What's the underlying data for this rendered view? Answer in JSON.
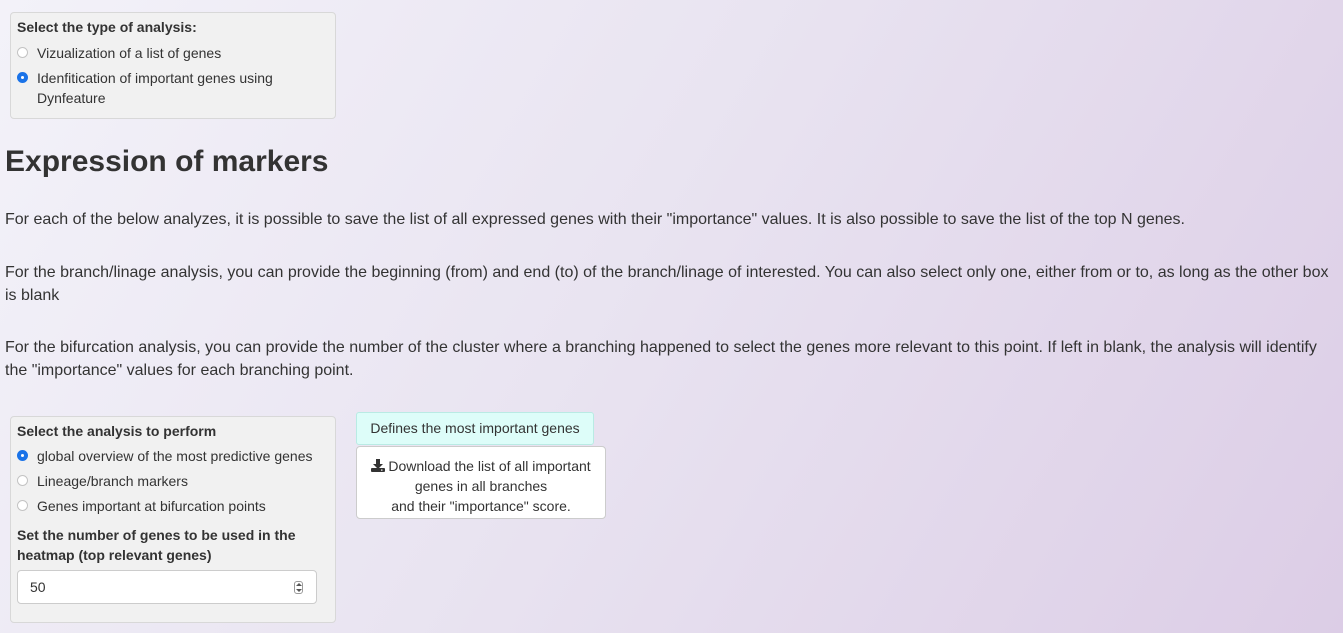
{
  "analysis_type": {
    "label": "Select the type of analysis:",
    "options": [
      {
        "label": "Vizualization of a list of genes",
        "checked": false
      },
      {
        "label": "Idenfitication of important genes using Dynfeature",
        "checked": true
      }
    ]
  },
  "main": {
    "title": "Expression of markers",
    "paragraphs": [
      "For each of the below analyzes, it is possible to save the list of all expressed genes with their \"importance\" values. It is also possible to save the list of the top N genes.",
      "For the branch/linage analysis, you can provide the beginning (from) and end (to) of the branch/linage of interested. You can also select only one, either from or to, as long as the other box is blank",
      "For the bifurcation analysis, you can provide the number of the cluster where a branching happened to select the genes more relevant to this point. If left in blank, the analysis will identify the \"importance\" values for each branching point."
    ]
  },
  "analysis_perform": {
    "label": "Select the analysis to perform",
    "options": [
      {
        "label": "global overview of the most predictive genes",
        "checked": true
      },
      {
        "label": "Lineage/branch markers",
        "checked": false
      },
      {
        "label": "Genes important at bifurcation points",
        "checked": false
      }
    ]
  },
  "genes_number": {
    "label": "Set the number of genes to be used in the heatmap (top relevant genes)",
    "value": "50"
  },
  "buttons": {
    "define_label": "Defines the most important genes",
    "download_icon": "download-icon",
    "download_lines": [
      "Download the list of all important",
      "genes in all branches",
      "and their \"importance\" score."
    ]
  },
  "colors": {
    "radio_checked": "#1a73e8",
    "primary_button_bg": "#ddfdf9",
    "well_bg": "#f1f1f1"
  }
}
